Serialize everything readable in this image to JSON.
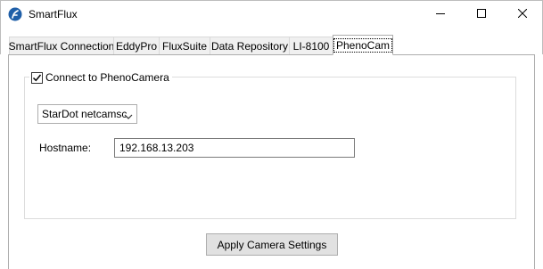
{
  "window": {
    "title": "SmartFlux",
    "app_icon": "flux-logo-icon",
    "controls": [
      "minimize-icon",
      "maximize-icon",
      "close-icon"
    ]
  },
  "tabs": [
    {
      "label": "SmartFlux Connection",
      "active": false
    },
    {
      "label": "EddyPro",
      "active": false
    },
    {
      "label": "FluxSuite",
      "active": false
    },
    {
      "label": "Data Repository",
      "active": false
    },
    {
      "label": "LI-8100",
      "active": false
    },
    {
      "label": "PhenoCam",
      "active": true
    }
  ],
  "phenocam": {
    "connect_label": "Connect to PhenoCamera",
    "connect_checked": true,
    "camera_model": "StarDot netcamsc",
    "hostname_label": "Hostname:",
    "hostname_value": "192.168.13.203",
    "apply_label": "Apply Camera Settings"
  }
}
